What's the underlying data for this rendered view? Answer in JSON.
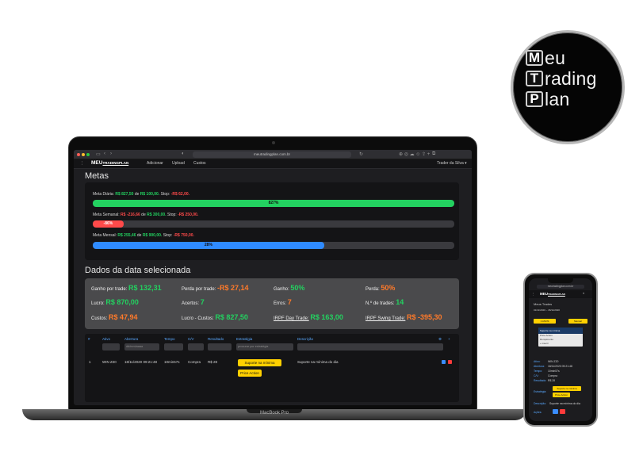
{
  "logo": {
    "letters": [
      "M",
      "T",
      "P"
    ],
    "words": [
      "eu",
      "rading",
      "lan"
    ]
  },
  "browser": {
    "url": "meutradingplan.com.br"
  },
  "nav": {
    "brand_main": "MEU",
    "brand_sub": "TRADINGPLAN",
    "items": [
      "Adicionar",
      "Upload",
      "Custos"
    ],
    "user": "Trader da Silva ▾"
  },
  "metas": {
    "title": "Metas",
    "diaria": {
      "label": "Meta Diária:",
      "value": "R$ 827,50",
      "de": "de",
      "target": "R$ 100,00.",
      "stop_label": "Stop:",
      "stop": "-R$ 62,00.",
      "pct_label": "827%",
      "pct": 100,
      "color": "#23d160"
    },
    "semanal": {
      "label": "Meta Semanal:",
      "value": "R$ -216,66",
      "de": "de",
      "target": "R$ 300,00.",
      "stop_label": "Stop:",
      "stop": "-R$ 250,00.",
      "pct_label": "-86%",
      "pct": 8.5,
      "color": "#ff4a4a"
    },
    "mensal": {
      "label": "Meta Mensal:",
      "value": "R$ 255,46",
      "de": "de",
      "target": "R$ 900,00.",
      "stop_label": "Stop:",
      "stop": "-R$ 750,00.",
      "pct_label": "28%",
      "pct": 64,
      "color": "#2f8bff"
    }
  },
  "dados": {
    "title": "Dados da data selecionada",
    "ganho_trade": {
      "label": "Ganho por trade:",
      "value": "R$ 132,31"
    },
    "perda_trade": {
      "label": "Perda por trade:",
      "value": "-R$ 27,14"
    },
    "ganho": {
      "label": "Ganho:",
      "value": "50%"
    },
    "perda": {
      "label": "Perda:",
      "value": "50%"
    },
    "lucro": {
      "label": "Lucro:",
      "value": "R$ 870,00"
    },
    "acertos": {
      "label": "Acertos:",
      "value": "7"
    },
    "erros": {
      "label": "Erros:",
      "value": "7"
    },
    "n_trades": {
      "label": "N.º de trades:",
      "value": "14"
    },
    "custos": {
      "label": "Custos:",
      "value": "R$ 47,94"
    },
    "lucro_custos": {
      "label": "Lucro - Custos:",
      "value": "R$ 827,50"
    },
    "irpf_day": {
      "label": "IRPF Day Trade:",
      "value": "R$ 163,00"
    },
    "irpf_swing": {
      "label": "IRPF Swing Trade:",
      "value": "R$ -395,30"
    }
  },
  "table": {
    "headers": [
      "#",
      "Ativo",
      "Abertura",
      "Tempo",
      "C/V",
      "Resultado",
      "Estratégia",
      "Descrição"
    ],
    "filters": {
      "abertura": "dd/mm/aaaa",
      "estrategia": "procurar por estratégia"
    },
    "row": {
      "num": "1",
      "ativo": "WIN Z20",
      "abertura": "18/11/2020 09:21:48",
      "tempo": "10min57s",
      "cv": "Compra",
      "resultado": "R$ 28",
      "estrategia_1": "Suporte na mínima",
      "estrategia_2": "Price Action",
      "descricao": "Suporte na mínima do dia"
    }
  },
  "laptop_model": "MacBook Pro",
  "phone": {
    "url": "meutradingplan.com.br",
    "title": "Meus Trades",
    "subtitle": "01/11/2020 – 18/11/2020",
    "filter_left": "1 ANOS",
    "filter_right": "Mensal",
    "dropdown": [
      "Suporte na mínima",
      "Price Action",
      "Rompimento",
      "+ inserir"
    ],
    "fields": [
      {
        "label": "Ativo:",
        "value": "WIN Z20"
      },
      {
        "label": "Abertura:",
        "value": "18/11/2020 09:21:48"
      },
      {
        "label": "Tempo:",
        "value": "10min57s"
      },
      {
        "label": "C/V:",
        "value": "Compra"
      },
      {
        "label": "Resultado:",
        "value": "R$ 28"
      }
    ],
    "estrategia_label": "Estratégia:",
    "estrategia_1": "Suporte na mínima",
    "estrategia_2": "Price Action",
    "descricao_label": "Descrição:",
    "descricao": "Suporte na mínima do dia",
    "acoes_label": "Ações:"
  }
}
